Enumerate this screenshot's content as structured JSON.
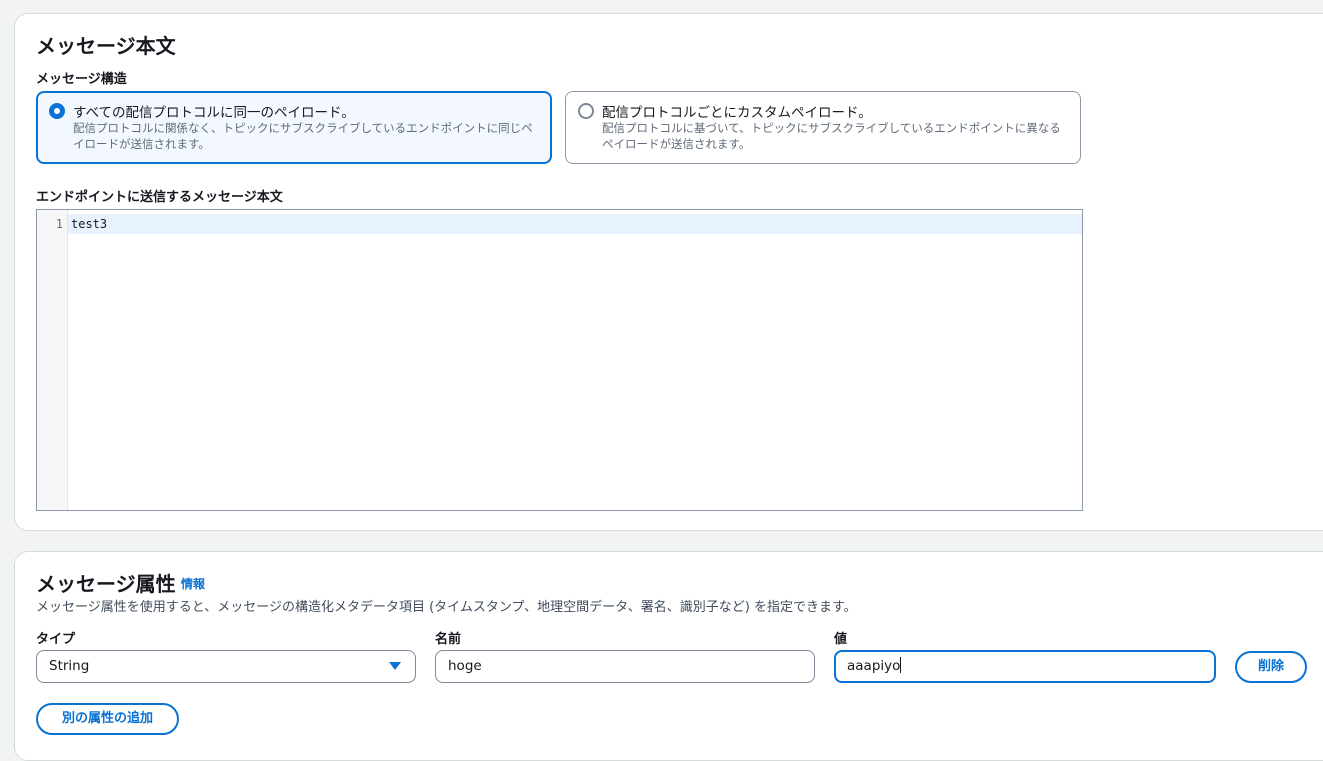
{
  "message_body_section": {
    "title": "メッセージ本文",
    "structure_label": "メッセージ構造",
    "options": [
      {
        "title": "すべての配信プロトコルに同一のペイロード。",
        "description": "配信プロトコルに関係なく、トピックにサブスクライブしているエンドポイントに同じペイロードが送信されます。",
        "selected": true
      },
      {
        "title": "配信プロトコルごとにカスタムペイロード。",
        "description": "配信プロトコルに基づいて、トピックにサブスクライブしているエンドポイントに異なるペイロードが送信されます。",
        "selected": false
      }
    ],
    "editor_label": "エンドポイントに送信するメッセージ本文",
    "editor": {
      "line_numbers": [
        "1"
      ],
      "lines": [
        "test3"
      ]
    }
  },
  "message_attributes_section": {
    "title": "メッセージ属性",
    "info_link": "情報",
    "description": "メッセージ属性を使用すると、メッセージの構造化メタデータ項目 (タイムスタンプ、地理空間データ、署名、識別子など) を指定できます。",
    "type_label": "タイプ",
    "name_label": "名前",
    "value_label": "値",
    "attribute": {
      "type": "String",
      "name": "hoge",
      "value": "aaapiyo"
    },
    "delete_button": "削除",
    "add_button": "別の属性の追加"
  },
  "colors": {
    "accent": "#0972d3",
    "selected_background": "#f2f8fd",
    "page_background": "#f2f3f3"
  },
  "icons": {
    "radio_selected": "radio-checked",
    "radio_unselected": "radio-unchecked",
    "select_caret": "triangle-down"
  }
}
